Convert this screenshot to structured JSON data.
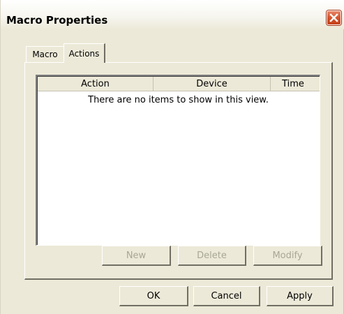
{
  "window": {
    "title": "Macro Properties",
    "close_icon": "close-icon"
  },
  "tabs": [
    {
      "label": "Macro",
      "selected": false
    },
    {
      "label": "Actions",
      "selected": true
    }
  ],
  "list": {
    "columns": [
      "Action",
      "Device",
      "Time"
    ],
    "empty_message": "There are no items to show in this view."
  },
  "list_buttons": {
    "new_label": "New",
    "delete_label": "Delete",
    "modify_label": "Modify"
  },
  "dialog_buttons": {
    "ok_label": "OK",
    "cancel_label": "Cancel",
    "apply_label": "Apply"
  },
  "colors": {
    "dialog_background": "#ece9d8",
    "close_button": "#d4542d",
    "disabled_text": "#a8a696"
  }
}
